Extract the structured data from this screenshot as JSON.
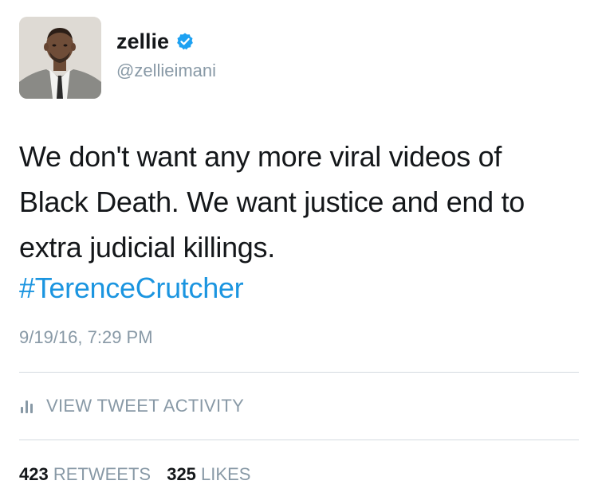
{
  "author": {
    "display_name": "zellie",
    "handle": "@zellieimani",
    "verified": true,
    "avatar_icon": "profile-photo"
  },
  "tweet": {
    "text": "We don't want any more viral videos of Black Death. We want justice and end to extra judicial killings.",
    "hashtag": "#TerenceCrutcher",
    "timestamp": "9/19/16, 7:29 PM"
  },
  "actions": {
    "view_activity_label": "VIEW TWEET ACTIVITY",
    "activity_icon": "bar-chart-icon"
  },
  "stats": {
    "retweets_count": "423",
    "retweets_label": "RETWEETS",
    "likes_count": "325",
    "likes_label": "LIKES"
  },
  "colors": {
    "link": "#1b95e0",
    "muted": "#8899a6",
    "text": "#14171a",
    "verified_badge": "#1da1f2"
  }
}
